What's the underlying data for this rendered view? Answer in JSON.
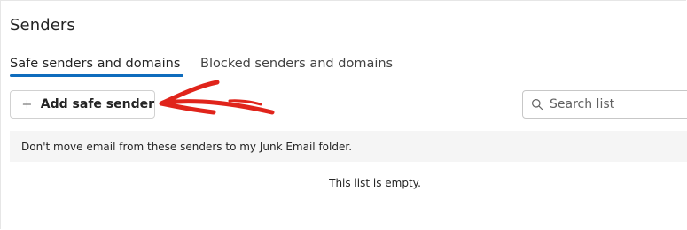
{
  "page": {
    "title": "Senders"
  },
  "tabs": [
    {
      "label": "Safe senders and domains",
      "active": true
    },
    {
      "label": "Blocked senders and domains",
      "active": false
    }
  ],
  "toolbar": {
    "add_label": "Add safe sender",
    "add_icon": "plus-icon",
    "search_icon": "search-icon",
    "search_placeholder": "Search list",
    "search_value": ""
  },
  "info": {
    "text": "Don't move email from these senders to my Junk Email folder."
  },
  "list": {
    "empty_text": "This list is empty."
  },
  "annotation": {
    "icon": "red-arrow-annotation",
    "color": "#e0241b"
  },
  "colors": {
    "accent": "#0f6cbd",
    "info_bar_bg": "#f5f5f5",
    "border": "#d1d1d1"
  }
}
